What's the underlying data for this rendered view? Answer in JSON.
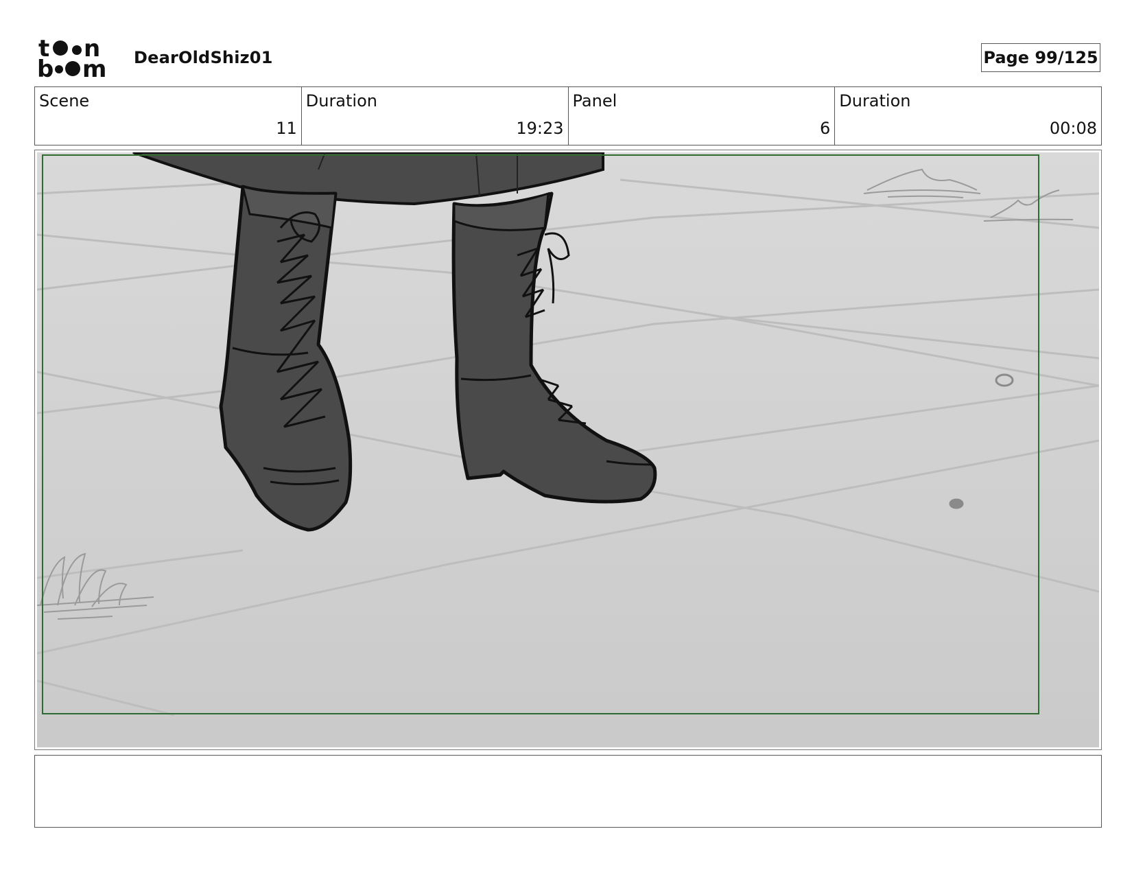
{
  "header": {
    "logo_text": "toon boom",
    "project_title": "DearOldShiz01",
    "page_label": "Page",
    "page_value": "99/125"
  },
  "info": {
    "scene_label": "Scene",
    "scene_value": "11",
    "scene_duration_label": "Duration",
    "scene_duration_value": "19:23",
    "panel_label": "Panel",
    "panel_value": "6",
    "panel_duration_label": "Duration",
    "panel_duration_value": "00:08"
  },
  "panel": {
    "safe_frame_color": "#2e6b2e",
    "floor_color": "#d2d2d2",
    "boot_color": "#4a4a4a"
  },
  "notes": {
    "text": ""
  }
}
